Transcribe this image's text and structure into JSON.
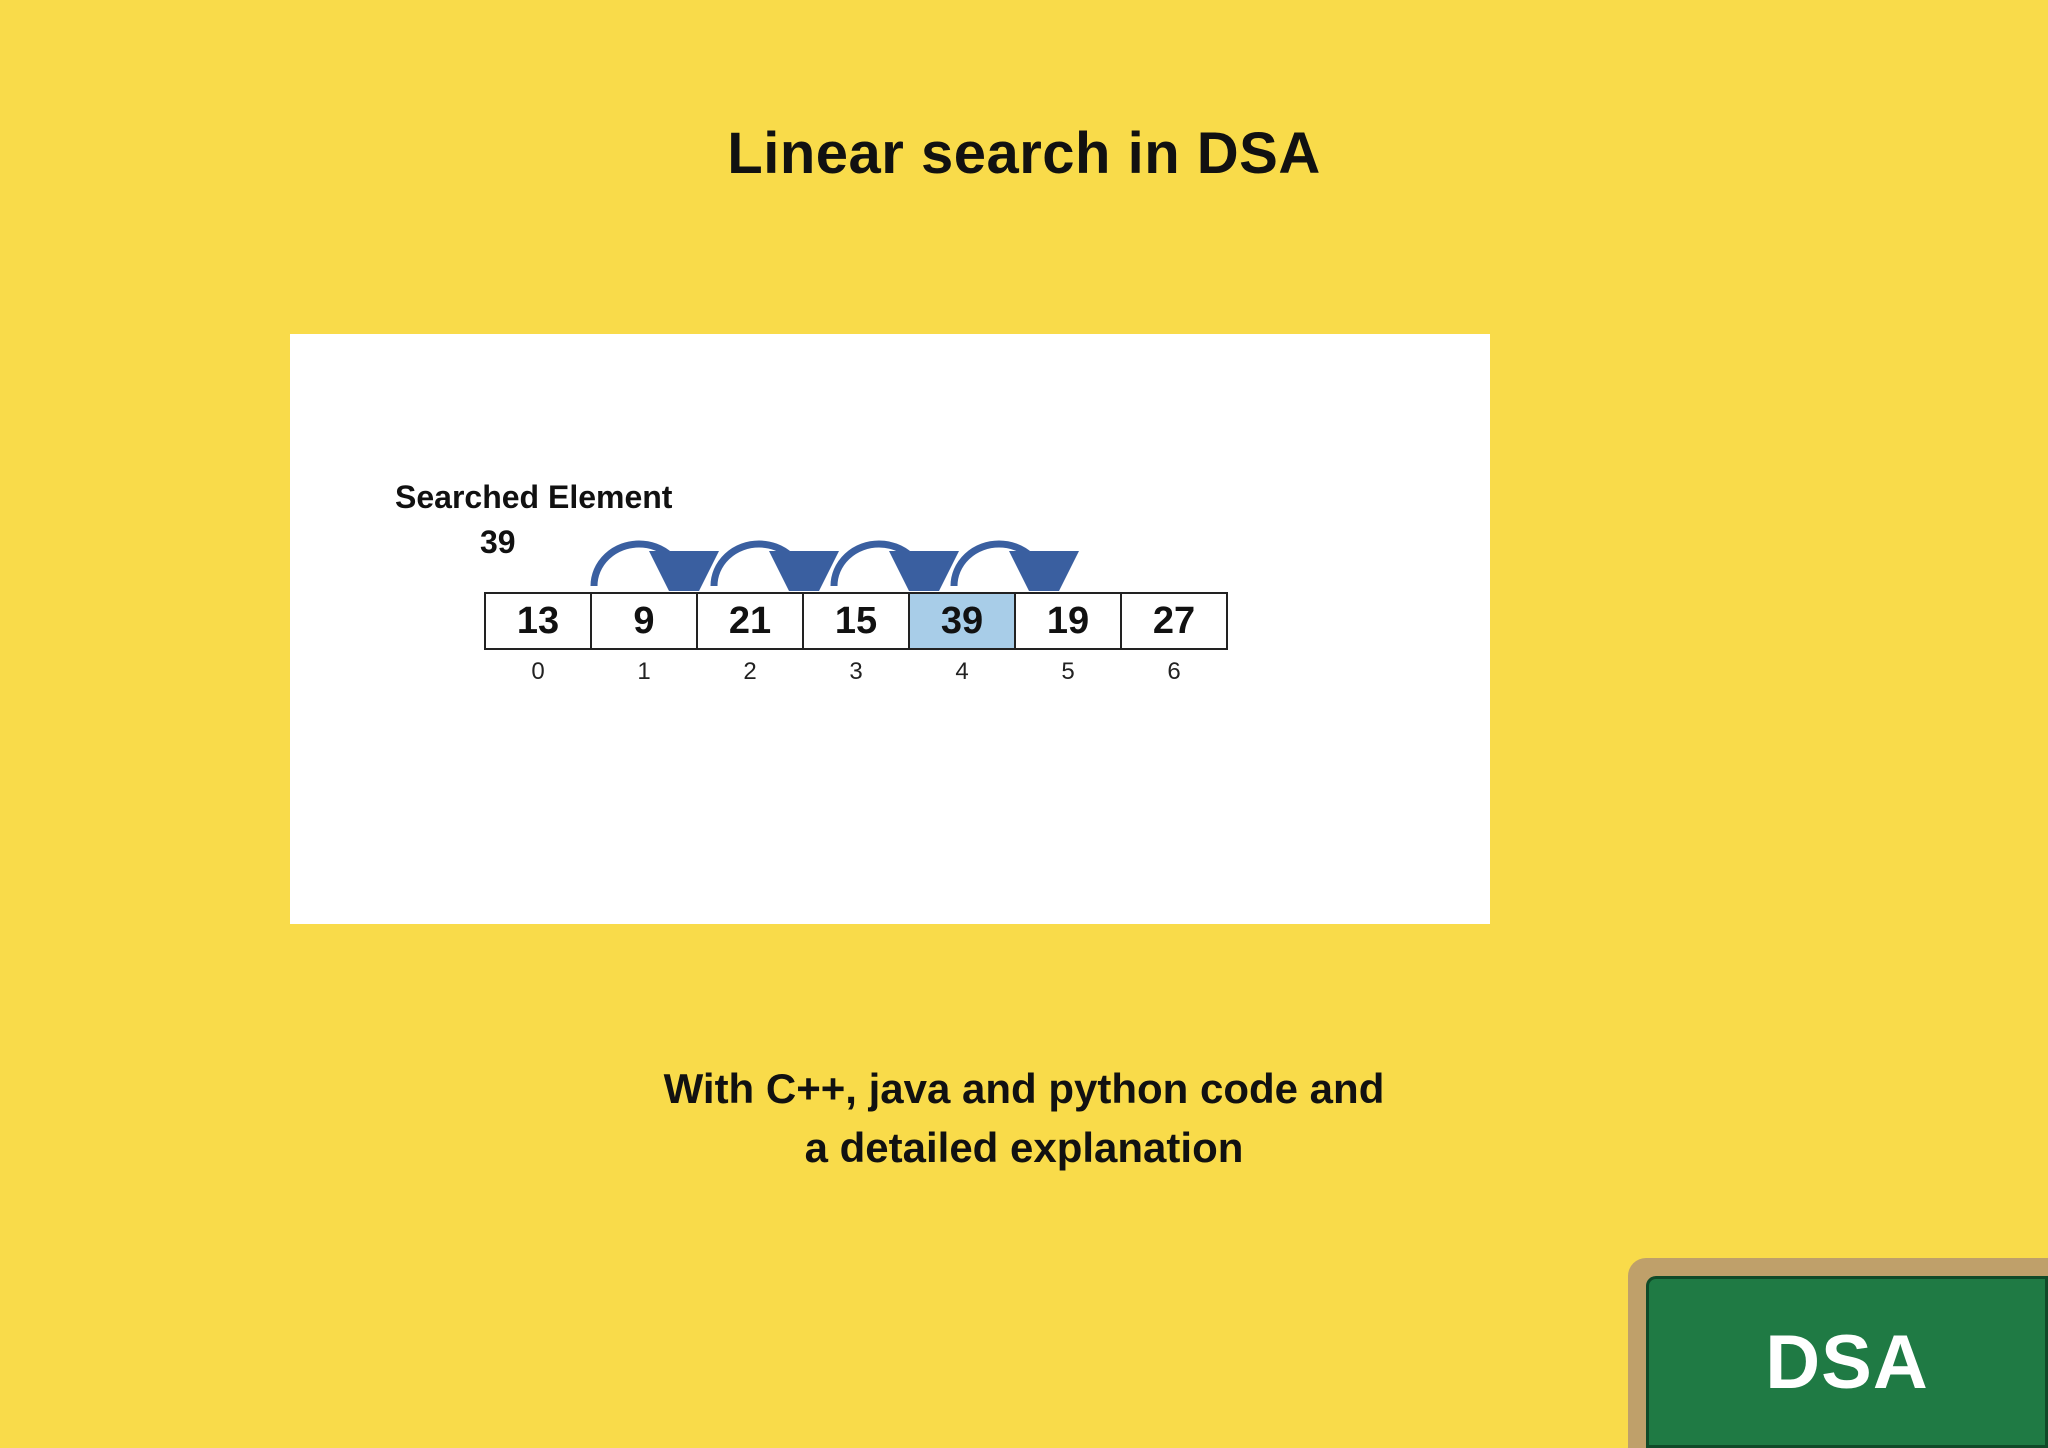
{
  "title": "Linear search in DSA",
  "panel": {
    "searched_label": "Searched Element",
    "searched_value": "39",
    "cells": [
      {
        "value": "13",
        "index": "0",
        "highlight": false
      },
      {
        "value": "9",
        "index": "1",
        "highlight": false
      },
      {
        "value": "21",
        "index": "2",
        "highlight": false
      },
      {
        "value": "15",
        "index": "3",
        "highlight": false
      },
      {
        "value": "39",
        "index": "4",
        "highlight": true
      },
      {
        "value": "19",
        "index": "5",
        "highlight": false
      },
      {
        "value": "27",
        "index": "6",
        "highlight": false
      }
    ],
    "arc_count": 4
  },
  "subtitle_line1": "With C++, java and python  code and",
  "subtitle_line2": "a detailed explanation",
  "badge": "DSA",
  "colors": {
    "background": "#f9db4a",
    "highlight": "#a8cde8",
    "arrow": "#3a5fa0",
    "badge_frame": "#bfa06a",
    "badge_fill": "#1f7a44"
  }
}
